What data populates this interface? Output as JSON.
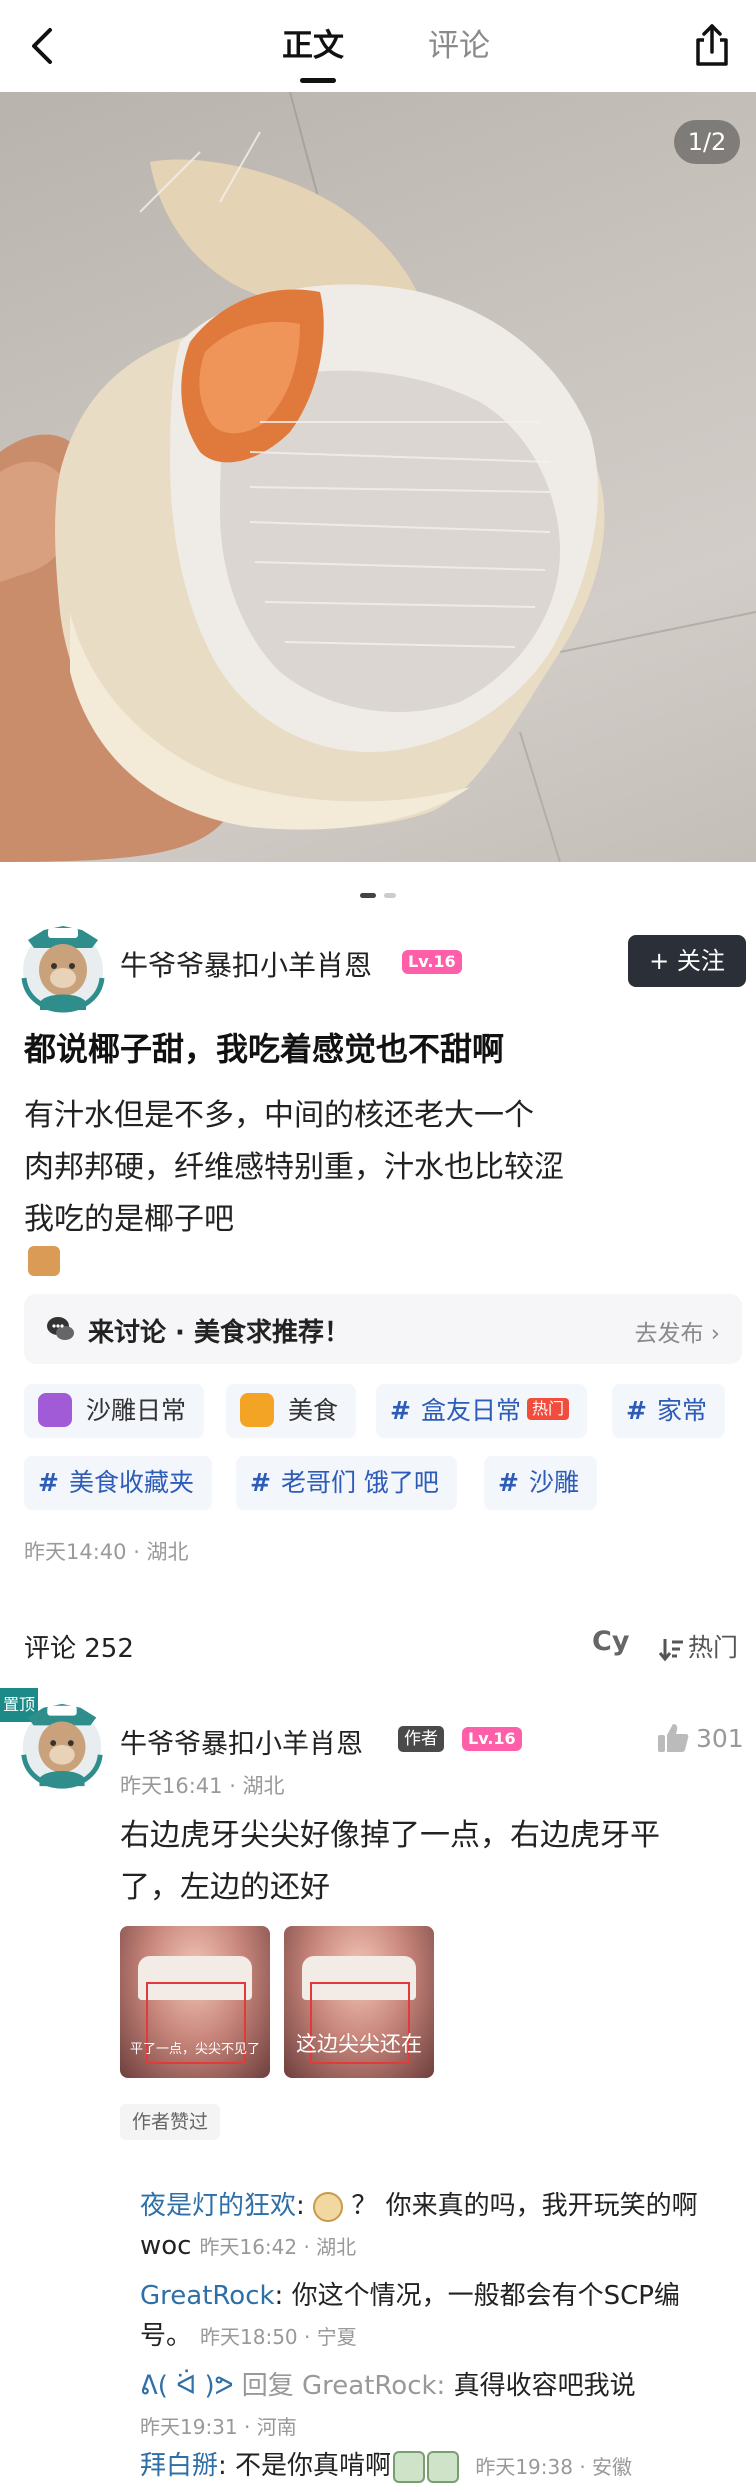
{
  "nav": {
    "tab_main": "正文",
    "tab_comments": "评论"
  },
  "photo": {
    "counter": "1/2",
    "description_icon": "coconut-photo"
  },
  "author": {
    "name": "牛爷爷暴扣小羊肖恩",
    "level": "Lv.16",
    "follow_label": "+ 关注"
  },
  "post": {
    "title": "都说椰子甜，我吃着感觉也不甜啊",
    "body_line1": "有汁水但是不多，中间的核还老大一个",
    "body_line2": "肉邦邦硬，纤维感特别重，汁水也比较涩",
    "body_line3": "我吃的是椰子吧",
    "meta": "昨天14:40 · 湖北"
  },
  "discussion": {
    "text": "来讨论 · 美食求推荐！",
    "action": "去发布"
  },
  "tags": [
    {
      "label": "沙雕日常",
      "kind": "icon",
      "icon": "doge-icon",
      "color": "#a15bd6"
    },
    {
      "label": "美食",
      "kind": "icon",
      "icon": "food-bowl-icon",
      "color": "#f4a425"
    },
    {
      "label": "盒友日常",
      "kind": "hash",
      "hot": "热门"
    },
    {
      "label": "家常",
      "kind": "hash"
    },
    {
      "label": "美食收藏夹",
      "kind": "hash"
    },
    {
      "label": "老哥们 饿了吧",
      "kind": "hash"
    },
    {
      "label": "沙雕",
      "kind": "hash"
    }
  ],
  "comments_header": {
    "count_label": "评论 252",
    "translate_label": "Cy",
    "sort_label": "热门"
  },
  "pinned_comment": {
    "pin_label": "置顶",
    "author": "牛爷爷暴扣小羊肖恩",
    "author_tag": "作者",
    "level": "Lv.16",
    "likes": "301",
    "meta": "昨天16:41 · 湖北",
    "text_line1": "右边虎牙尖尖好像掉了一点，右边虎牙平",
    "text_line2": "了，左边的还好",
    "images": [
      {
        "caption": "平了一点，尖尖不见了"
      },
      {
        "caption": "这边尖尖还在"
      }
    ],
    "liked_by_author": "作者赞过"
  },
  "replies": [
    {
      "name": "夜是灯的狂欢",
      "text": "？ 你来真的吗，我开玩笑的啊",
      "cont": "woc",
      "meta": "昨天16:42 · 湖北"
    },
    {
      "name": "GreatRock",
      "text": "你这个情况，一般都会有个SCP编",
      "cont": "号。",
      "meta": "昨天18:50 · 宁夏"
    },
    {
      "name": "ᕕ( ᐛ )ᕗ",
      "reply_to": "回复 GreatRock:",
      "text": "真得收容吧我说",
      "meta": "昨天19:31 · 河南"
    },
    {
      "name": "拜白掰",
      "text": "不是你真啃啊",
      "meta": "昨天19:38 · 安徽"
    }
  ],
  "colors": {
    "accent_blue": "#2e6fa8",
    "level_pink": "#ff5fa8",
    "follow_dark": "#2b2f38",
    "pin_teal": "#1c8a86"
  }
}
